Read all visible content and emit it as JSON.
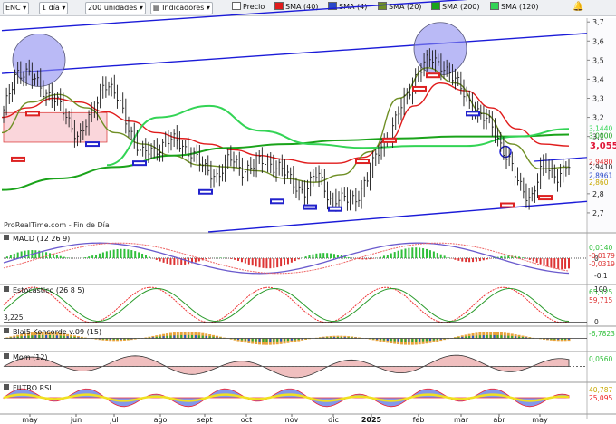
{
  "toolbar": {
    "symbol": "ENC",
    "period": "1 día",
    "units": "200 unidades",
    "indicators": "Indicadores",
    "legend": [
      {
        "label": "Precio",
        "color": "#222222"
      },
      {
        "label": "SMA (40)",
        "color": "#e01b1b"
      },
      {
        "label": "SMA (4)",
        "color": "#2a49c8"
      },
      {
        "label": "SMA (20)",
        "color": "#6f8f25"
      },
      {
        "label": "SMA (200)",
        "color": "#1aa31a"
      },
      {
        "label": "SMA (120)",
        "color": "#33d455"
      }
    ],
    "alert_icon": "bell-alert-icon"
  },
  "source": "ProRealTime.com - Fin de Día",
  "colors": {
    "price_axis_current": "#e0193a",
    "trend_lines": "#1b1bd8",
    "circle": "#8c8cf0",
    "box": "#f5b5bd"
  },
  "chart_data": [
    {
      "type": "line",
      "panel": "price",
      "x": [
        "may",
        "jun",
        "jul",
        "ago",
        "sept",
        "oct",
        "nov",
        "dic",
        "2025",
        "feb",
        "mar",
        "abr",
        "may"
      ],
      "ylim": [
        2.6,
        3.72
      ],
      "yticks": [
        2.7,
        2.8,
        3.1,
        3.2,
        3.3,
        3.4,
        3.5,
        3.6,
        3.7
      ],
      "ytick_labels": [
        "2,7",
        "2,8",
        "3,1",
        "3,2",
        "3,3",
        "3,4",
        "3,5",
        "3,6",
        "3,7"
      ],
      "price_labels": [
        {
          "text": "3,055",
          "value": 3.055,
          "color": "#e0193a"
        },
        {
          "text": "3,1440",
          "value": 3.144,
          "color": "#33d455"
        },
        {
          "text": "3,0000",
          "value": 3.105,
          "color": "#1aa31a"
        },
        {
          "text": "2,9480",
          "value": 2.968,
          "color": "#e01b1b"
        },
        {
          "text": "2,9410",
          "value": 2.941,
          "color": "#222222"
        },
        {
          "text": "2,8961",
          "value": 2.896,
          "color": "#2a49c8"
        },
        {
          "text": "2,860",
          "value": 2.86,
          "color": "#c8a800"
        }
      ],
      "close": [
        3.22,
        3.45,
        3.42,
        3.36,
        3.3,
        3.2,
        3.1,
        3.2,
        3.4,
        3.3,
        3.15,
        3.0,
        3.03,
        3.08,
        3.06,
        3.02,
        2.92,
        2.9,
        2.98,
        2.93,
        2.95,
        2.97,
        2.94,
        2.85,
        2.82,
        2.9,
        2.78,
        2.76,
        2.78,
        2.88,
        3.05,
        3.15,
        3.3,
        3.45,
        3.5,
        3.48,
        3.38,
        3.3,
        3.2,
        3.15,
        3.0,
        2.85,
        2.78,
        2.95,
        2.9,
        2.94
      ],
      "series": [
        {
          "name": "SMA (40)",
          "color": "#e01b1b",
          "values": [
            3.2,
            3.25,
            3.3,
            3.28,
            3.23,
            3.18,
            3.12,
            3.09,
            3.06,
            3.03,
            3.0,
            2.98,
            2.96,
            2.96,
            2.99,
            3.08,
            3.26,
            3.38,
            3.34,
            3.25,
            3.14,
            3.06,
            3.05
          ]
        },
        {
          "name": "SMA (20)",
          "color": "#6f8f25",
          "values": [
            3.12,
            3.28,
            3.32,
            3.25,
            3.12,
            3.06,
            3.0,
            2.95,
            2.94,
            2.92,
            2.88,
            2.86,
            2.9,
            3.02,
            3.3,
            3.46,
            3.38,
            3.22,
            3.06,
            2.93,
            2.94
          ]
        },
        {
          "name": "SMA (200)",
          "color": "#1aa31a",
          "values": [
            2.82,
            2.88,
            2.94,
            3.0,
            3.04,
            3.06,
            3.08,
            3.09,
            3.1,
            3.1,
            3.11
          ]
        },
        {
          "name": "SMA (120)",
          "color": "#33d455",
          "values": [
            2.95,
            3.2,
            3.26,
            3.13,
            3.06,
            3.04,
            3.05,
            3.05,
            3.1,
            3.14
          ]
        }
      ]
    },
    {
      "type": "area",
      "panel": "MACD",
      "title": "MACD (12 26 9)",
      "ylim": [
        -0.1,
        0.1
      ],
      "yticks": [
        0,
        -0.1
      ],
      "ytick_labels": [
        "0",
        "-0,1"
      ],
      "values_label": [
        "0,0140",
        "-0,0179",
        "-0,0319"
      ]
    },
    {
      "type": "line",
      "panel": "stochastic",
      "title": "Estocástico (26 8 5)",
      "ylim": [
        0,
        100
      ],
      "yticks": [
        100,
        0
      ],
      "ytick_labels": [
        "100",
        "0"
      ],
      "values_label": [
        "65,325",
        "59,715"
      ],
      "side_label": "3,225"
    },
    {
      "type": "area",
      "panel": "koncorde",
      "title": "Blai5 Koncorde v.09 (15)",
      "values_label": [
        "-6,7823"
      ]
    },
    {
      "type": "area",
      "panel": "momentum",
      "title": "Mom (12)",
      "values_label": [
        "0,0560"
      ]
    },
    {
      "type": "area",
      "panel": "rsi",
      "title": "FILTRO RSI",
      "values_label": [
        "40,787",
        "25,095"
      ]
    }
  ]
}
